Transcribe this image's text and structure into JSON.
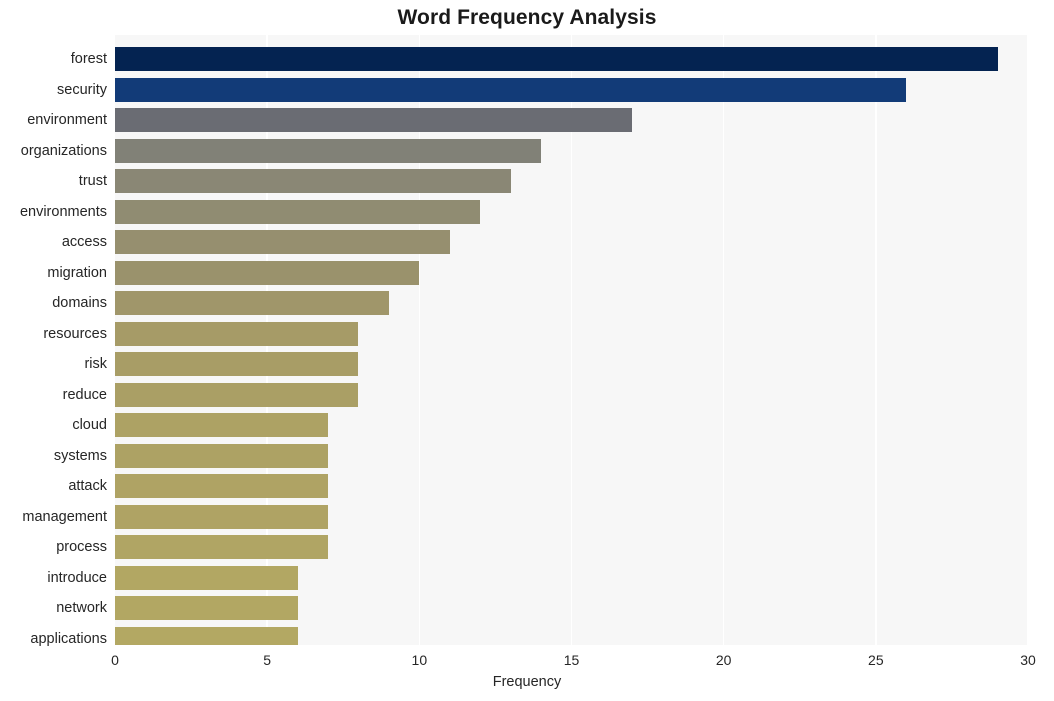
{
  "chart_data": {
    "type": "bar",
    "orientation": "horizontal",
    "title": "Word Frequency Analysis",
    "xlabel": "Frequency",
    "ylabel": "",
    "xlim": [
      0,
      30
    ],
    "xticks": [
      0,
      5,
      10,
      15,
      20,
      25,
      30
    ],
    "xtick_labels": [
      "0",
      "5",
      "10",
      "15",
      "20",
      "25",
      "30"
    ],
    "grid": "vertical-white-on-light-gray",
    "legend": null,
    "categories": [
      "forest",
      "security",
      "environment",
      "organizations",
      "trust",
      "environments",
      "access",
      "migration",
      "domains",
      "resources",
      "risk",
      "reduce",
      "cloud",
      "systems",
      "attack",
      "management",
      "process",
      "introduce",
      "network",
      "applications"
    ],
    "values": [
      29,
      26,
      17,
      14,
      13,
      12,
      11,
      10,
      9,
      8,
      8,
      8,
      7,
      7,
      7,
      7,
      7,
      6,
      6,
      6
    ],
    "bar_colors": [
      "#042351",
      "#123b78",
      "#6a6c73",
      "#818177",
      "#8a8775",
      "#908c72",
      "#968f6f",
      "#9a926c",
      "#a0966a",
      "#a69b67",
      "#a89d66",
      "#aa9f65",
      "#ada264",
      "#ada264",
      "#afa364",
      "#afa364",
      "#b0a564",
      "#b2a763",
      "#b2a763",
      "#b3a863"
    ],
    "plot_background": "#f7f7f7",
    "figure_background": "#ffffff",
    "gridline_color": "#ffffff",
    "text_color": "#262626"
  }
}
